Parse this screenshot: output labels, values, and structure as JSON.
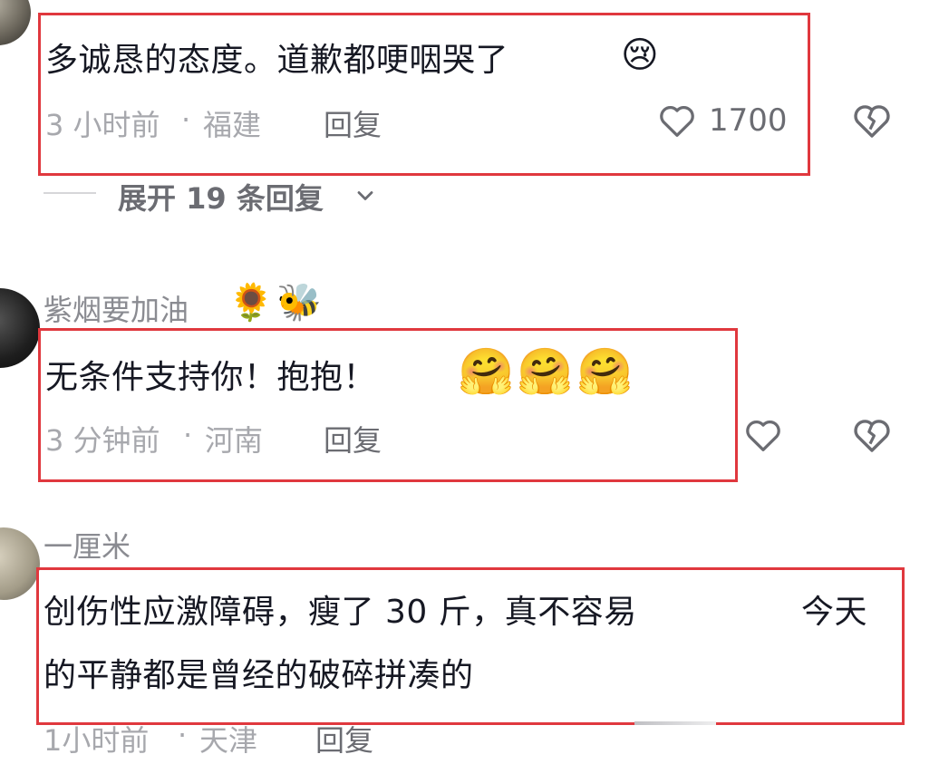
{
  "comments": [
    {
      "text": "多诚恳的态度。道歉都哽咽哭了",
      "emoji": [
        "😢"
      ],
      "time": "3 小时前",
      "sep": "·",
      "location": "福建",
      "reply": "回复",
      "likes": "1700",
      "expand": "展开 19 条回复",
      "icons": {
        "like": "heart-icon",
        "dislike": "broken-heart-icon",
        "expand": "chevron-down-icon"
      }
    },
    {
      "username": "紫烟要加油",
      "username_emoji": [
        "🌻",
        "🐝"
      ],
      "text": "无条件支持你！抱抱！",
      "emoji": [
        "🤗",
        "🤗",
        "🤗"
      ],
      "time": "3 分钟前",
      "sep": "·",
      "location": "河南",
      "reply": "回复"
    },
    {
      "username": "一厘米",
      "text_line1": "创伤性应激障碍，瘦了 30 斤，真不容易",
      "text_line1_tail": "今天",
      "text_line2": "的平静都是曾经的破碎拼凑的",
      "time": "1小时前",
      "sep": "·",
      "location": "天津",
      "reply": "回复"
    }
  ],
  "colors": {
    "highlight_box": "#e0383e",
    "meta_text": "#a7a8ad",
    "body_text": "#161823"
  }
}
